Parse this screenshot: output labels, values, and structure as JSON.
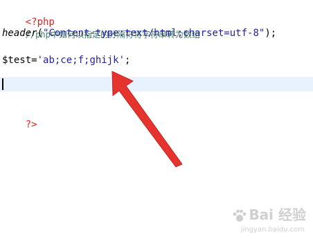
{
  "code": {
    "line1": {
      "tag": "<?php"
    },
    "line2": {
      "comment": "//php中如何以指定的分隔符将字符串转为数组"
    },
    "line3": {
      "func": "header",
      "open": "(",
      "string": "\"Content-type:text/html;charset=utf-8\"",
      "close": ");"
    },
    "line4": {
      "variable": "$test",
      "assign": "=",
      "string": "'ab;ce;f;ghijk'",
      "end": ";"
    },
    "line5": {
      "tag": "?>"
    }
  },
  "watermark": {
    "brand": "Bai 经验",
    "url": "jingyan.baidu.com"
  },
  "colors": {
    "php_tag": "#d6281e",
    "comment": "#3f7f5f",
    "string": "#1f1fa8",
    "current_line": "#e8f2fe",
    "arrow": "#e5332e"
  }
}
